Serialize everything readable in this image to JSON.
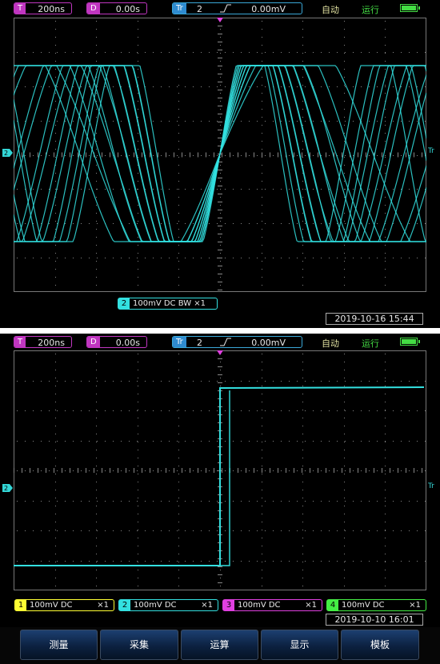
{
  "screen1": {
    "timebase": {
      "tag": "T",
      "value": "200ns"
    },
    "delay": {
      "tag": "D",
      "value": "0.00s"
    },
    "trigger": {
      "tag": "Tr",
      "channel": "2",
      "edge": "rising-edge-icon",
      "level": "0.00mV"
    },
    "mode": "自动",
    "status": "运行",
    "channels": [
      {
        "num": "2",
        "text": "100mV  DC  BW   ×1",
        "color": "#33e0e0"
      }
    ],
    "datetime": "2019-10-16  15:44",
    "level_marker": "Tr",
    "channel_marker": "2"
  },
  "screen2": {
    "timebase": {
      "tag": "T",
      "value": "200ns"
    },
    "delay": {
      "tag": "D",
      "value": "0.00s"
    },
    "trigger": {
      "tag": "Tr",
      "channel": "2",
      "edge": "rising-edge-icon",
      "level": "0.00mV"
    },
    "mode": "自动",
    "status": "运行",
    "channels": [
      {
        "num": "1",
        "text": "100mV  DC",
        "mult": "×1",
        "color": "#ffff33"
      },
      {
        "num": "2",
        "text": "100mV  DC",
        "mult": "×1",
        "color": "#33e0e0"
      },
      {
        "num": "3",
        "text": "100mV  DC",
        "mult": "×1",
        "color": "#e040e0"
      },
      {
        "num": "4",
        "text": "100mV  DC",
        "mult": "×1",
        "color": "#44ee44"
      }
    ],
    "datetime": "2019-10-10  16:01",
    "level_marker": "Tr",
    "channel_marker": "2"
  },
  "menu": [
    "测量",
    "采集",
    "运算",
    "显示",
    "模板"
  ],
  "colors": {
    "trace": "#33e0e0",
    "grid": "#666666",
    "accent_magenta": "#c036c0",
    "accent_blue": "#2f8bd0",
    "run": "#44dd44"
  }
}
